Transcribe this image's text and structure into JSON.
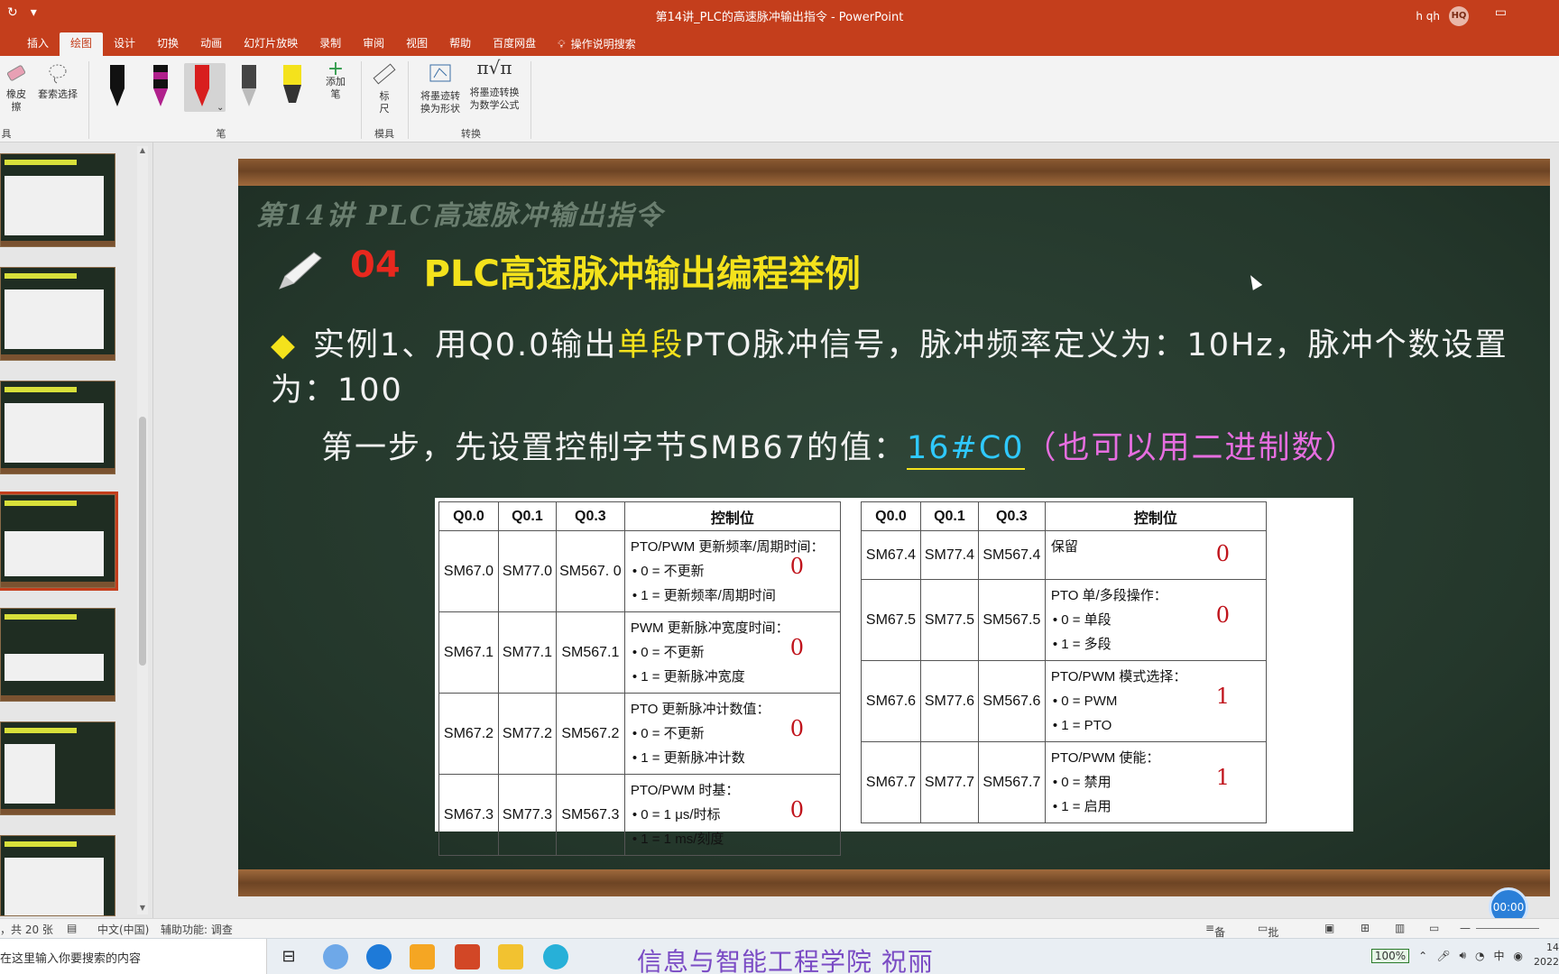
{
  "app": {
    "window_title": "第14讲_PLC的高速脉冲输出指令  -  PowerPoint",
    "user_name": "h qh",
    "user_initials": "HQ"
  },
  "ribbon_tabs": [
    "插入",
    "绘图",
    "设计",
    "切换",
    "动画",
    "幻灯片放映",
    "录制",
    "审阅",
    "视图",
    "帮助",
    "百度网盘"
  ],
  "active_tab": "绘图",
  "tell_me": "操作说明搜索",
  "ribbon": {
    "eraser_label_1": "橡皮",
    "eraser_label_2": "擦",
    "lasso_label": "套索选择",
    "tools_group": "具",
    "pens_group": "笔",
    "add_pen_1": "添加",
    "add_pen_2": "笔",
    "ruler_1": "标",
    "ruler_2": "尺",
    "stencils_group": "模具",
    "ink_shape_1": "将墨迹转",
    "ink_shape_2": "换为形状",
    "ink_math_1": "将墨迹转换",
    "ink_math_2": "为数学公式",
    "convert_group": "转换",
    "pen_colors": [
      "#111111",
      "#b0208c",
      "#d81e1e",
      "#444444",
      "#f4e21c"
    ]
  },
  "slide": {
    "header": "第14讲 PLC高速脉冲输出指令",
    "section_num": "04",
    "section_title": "PLC高速脉冲输出编程举例",
    "example_prefix": "实例1、用Q0.0输出",
    "example_highlight": "单段",
    "example_suffix": "PTO脉冲信号，脉冲频率定义为：10Hz，脉冲个数设置为：100",
    "step_text": "第一步，先设置控制字节SMB67的值：",
    "step_value": "16#C0",
    "step_note": "（也可以用二进制数）",
    "table_headers": [
      "Q0.0",
      "Q0.1",
      "Q0.3",
      "控制位"
    ],
    "left_rows": [
      {
        "q00": "SM67.0",
        "q01": "SM77.0",
        "q03": "SM567. 0",
        "title": "PTO/PWM 更新频率/周期时间：",
        "opt1": "0 = 不更新",
        "opt2": "1 = 更新频率/周期时间",
        "mark": "0"
      },
      {
        "q00": "SM67.1",
        "q01": "SM77.1",
        "q03": "SM567.1",
        "title": "PWM 更新脉冲宽度时间：",
        "opt1": "0 = 不更新",
        "opt2": "1 = 更新脉冲宽度",
        "mark": "0"
      },
      {
        "q00": "SM67.2",
        "q01": "SM77.2",
        "q03": "SM567.2",
        "title": "PTO 更新脉冲计数值：",
        "opt1": "0 = 不更新",
        "opt2": "1 = 更新脉冲计数",
        "mark": "0"
      },
      {
        "q00": "SM67.3",
        "q01": "SM77.3",
        "q03": "SM567.3",
        "title": "PTO/PWM 时基：",
        "opt1": "0 = 1 μs/时标",
        "opt2": "1 = 1 ms/刻度",
        "mark": "0"
      }
    ],
    "right_rows": [
      {
        "q00": "SM67.4",
        "q01": "SM77.4",
        "q03": "SM567.4",
        "title": "保留",
        "opt1": "",
        "opt2": "",
        "mark": "0"
      },
      {
        "q00": "SM67.5",
        "q01": "SM77.5",
        "q03": "SM567.5",
        "title": "PTO 单/多段操作：",
        "opt1": "0 = 单段",
        "opt2": "1 = 多段",
        "mark": "0"
      },
      {
        "q00": "SM67.6",
        "q01": "SM77.6",
        "q03": "SM567.6",
        "title": "PTO/PWM 模式选择：",
        "opt1": "0 = PWM",
        "opt2": "1 = PTO",
        "mark": "1"
      },
      {
        "q00": "SM67.7",
        "q01": "SM77.7",
        "q03": "SM567.7",
        "title": "PTO/PWM 使能：",
        "opt1": "0 = 禁用",
        "opt2": "1 = 启用",
        "mark": "1"
      }
    ]
  },
  "timer": "00:00",
  "status": {
    "slide_count": "，共 20 张",
    "language": "中文(中国)",
    "accessibility": "辅助功能: 调查",
    "notes": "备注",
    "comments": "批注"
  },
  "taskbar": {
    "search_placeholder": "在这里输入你要搜索的内容",
    "banner": "信息与智能工程学院  祝丽",
    "battery": "100%",
    "ime": "中",
    "clock_line1": "14",
    "clock_line2": "2022"
  }
}
